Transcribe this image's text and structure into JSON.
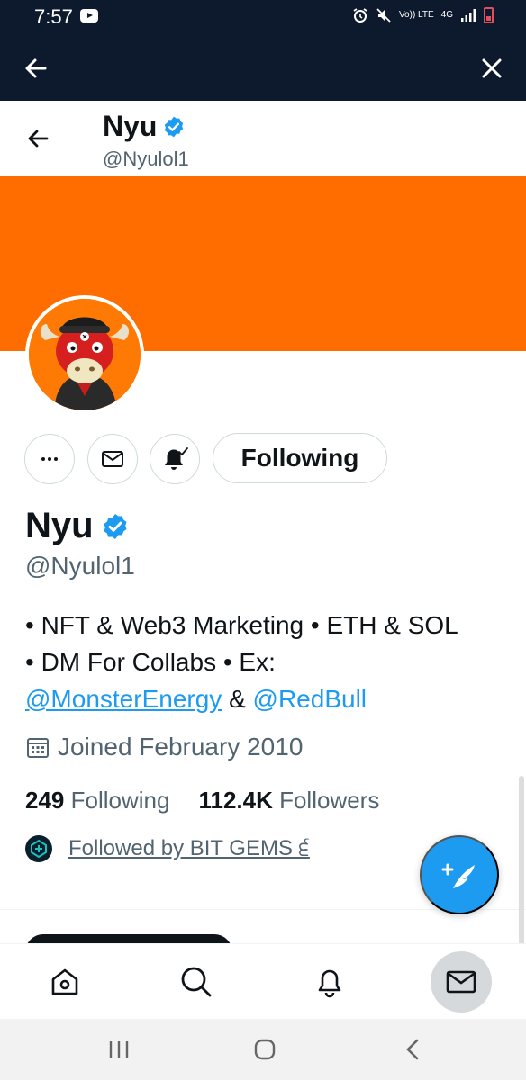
{
  "status_bar": {
    "time": "7:57",
    "network_top": "4G",
    "volte_label": "Vo)) LTE"
  },
  "browser": {
    "back_icon": "arrow-left-icon",
    "close_icon": "close-icon"
  },
  "header": {
    "name": "Nyu",
    "handle": "@Nyulol1"
  },
  "colors": {
    "banner": "#ff6d00",
    "accent": "#1d9bf0",
    "text": "#0f1419",
    "muted": "#536471"
  },
  "actions": {
    "more_icon": "more-horizontal-icon",
    "message_icon": "envelope-icon",
    "notify_icon": "bell-check-icon",
    "following_label": "Following"
  },
  "profile": {
    "name": "Nyu",
    "handle": "@Nyulol1",
    "bio": {
      "line1": "• NFT & Web3 Marketing • ETH & SOL",
      "line2": "• DM For Collabs •  Ex:",
      "mention1": "@MonsterEnergy",
      "amp": " & ",
      "mention2": "@RedBull"
    },
    "joined": "Joined February 2010",
    "following_count": "249",
    "following_label": "Following",
    "followers_count": "112.4K",
    "followers_label": "Followers",
    "followed_by": "Followed by BIT GEMS ੬"
  },
  "bottom_nav": {
    "items": [
      "home-icon",
      "search-icon",
      "bell-icon",
      "envelope-icon"
    ]
  }
}
